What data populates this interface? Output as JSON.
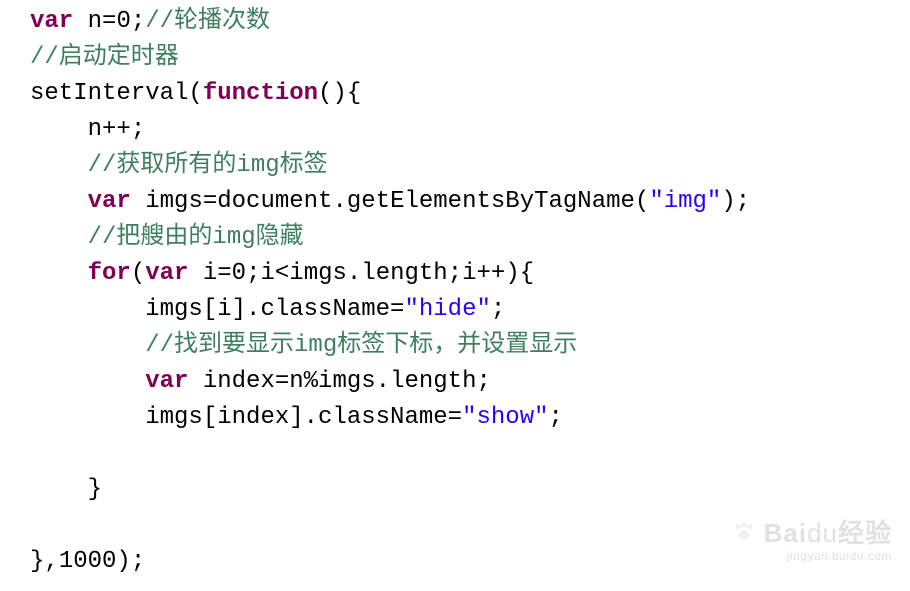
{
  "code": {
    "tokens": [
      [
        {
          "t": "kw",
          "v": "var"
        },
        {
          "t": "pun",
          "v": " n="
        },
        {
          "t": "num",
          "v": "0"
        },
        {
          "t": "pun",
          "v": ";"
        },
        {
          "t": "cmt",
          "v": "//轮播次数"
        }
      ],
      [
        {
          "t": "cmt",
          "v": "//启动定时器"
        }
      ],
      [
        {
          "t": "id",
          "v": "setInterval("
        },
        {
          "t": "kw",
          "v": "function"
        },
        {
          "t": "pun",
          "v": "(){"
        }
      ],
      [
        {
          "t": "pun",
          "v": "    n++;"
        }
      ],
      [
        {
          "t": "pun",
          "v": "    "
        },
        {
          "t": "cmt",
          "v": "//获取所有的img标签"
        }
      ],
      [
        {
          "t": "pun",
          "v": "    "
        },
        {
          "t": "kw",
          "v": "var"
        },
        {
          "t": "pun",
          "v": " imgs=document.getElementsByTagName("
        },
        {
          "t": "str",
          "v": "\"img\""
        },
        {
          "t": "pun",
          "v": ");"
        }
      ],
      [
        {
          "t": "pun",
          "v": "    "
        },
        {
          "t": "cmt",
          "v": "//把艘由的img隐藏"
        }
      ],
      [
        {
          "t": "pun",
          "v": "    "
        },
        {
          "t": "kw",
          "v": "for"
        },
        {
          "t": "pun",
          "v": "("
        },
        {
          "t": "kw",
          "v": "var"
        },
        {
          "t": "pun",
          "v": " i="
        },
        {
          "t": "num",
          "v": "0"
        },
        {
          "t": "pun",
          "v": ";i<imgs.length;i++){"
        }
      ],
      [
        {
          "t": "pun",
          "v": "        imgs[i].className="
        },
        {
          "t": "str",
          "v": "\"hide\""
        },
        {
          "t": "pun",
          "v": ";"
        }
      ],
      [
        {
          "t": "pun",
          "v": "        "
        },
        {
          "t": "cmt",
          "v": "//找到要显示img标签下标，并设置显示"
        }
      ],
      [
        {
          "t": "pun",
          "v": "        "
        },
        {
          "t": "kw",
          "v": "var"
        },
        {
          "t": "pun",
          "v": " index=n%imgs.length;"
        }
      ],
      [
        {
          "t": "pun",
          "v": "        imgs[index].className="
        },
        {
          "t": "str",
          "v": "\"show\""
        },
        {
          "t": "pun",
          "v": ";"
        }
      ],
      [
        {
          "t": "pun",
          "v": ""
        }
      ],
      [
        {
          "t": "pun",
          "v": "    }"
        }
      ],
      [
        {
          "t": "pun",
          "v": ""
        }
      ],
      [
        {
          "t": "pun",
          "v": "},"
        },
        {
          "t": "num",
          "v": "1000"
        },
        {
          "t": "pun",
          "v": ");"
        }
      ]
    ]
  },
  "watermark": {
    "brand_b": "Bai",
    "brand_rest": "du",
    "brand_cn": "经验",
    "sub": "jingyan.baidu.com"
  }
}
